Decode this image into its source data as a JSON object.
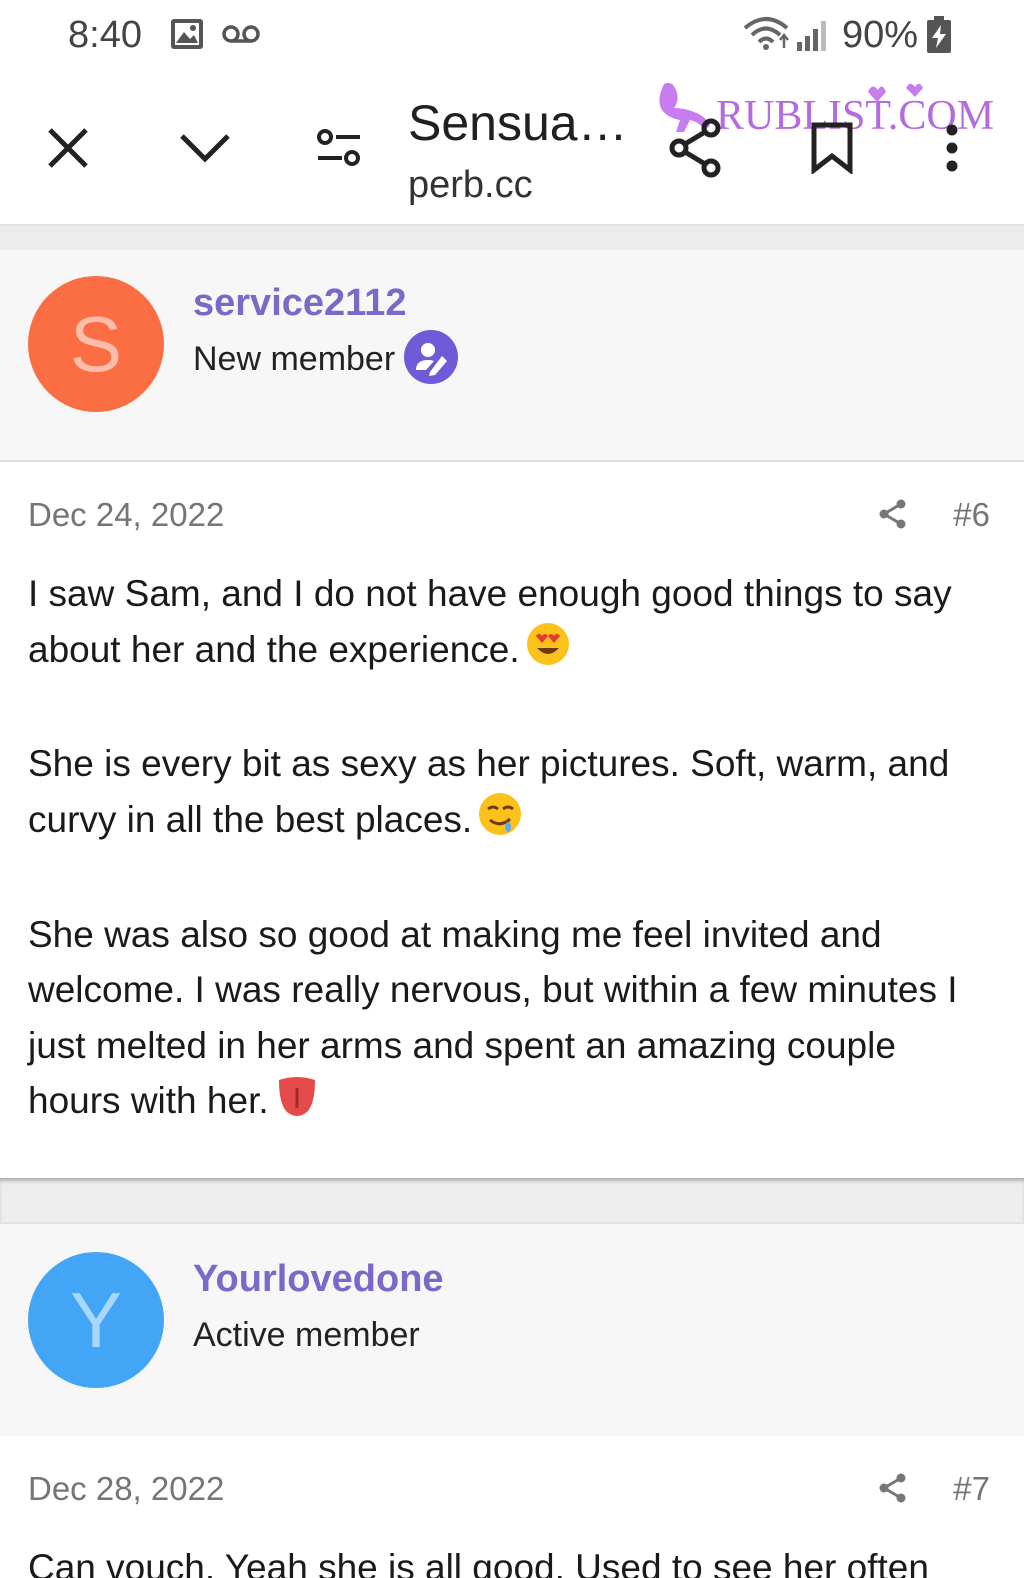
{
  "status_bar": {
    "time": "8:40",
    "battery": "90%",
    "icons": [
      "image-icon",
      "voicemail-icon",
      "wifi-icon",
      "signal-icon",
      "battery-charging-icon"
    ]
  },
  "toolbar": {
    "title": "Sensua…",
    "domain": "perb.cc",
    "icons": [
      "close-icon",
      "chevron-down-icon",
      "tune-icon",
      "share-icon",
      "bookmark-icon",
      "more-vert-icon"
    ]
  },
  "watermark": {
    "text": "RUBLIST.COM"
  },
  "posts": [
    {
      "avatar_letter": "S",
      "avatar_color": "#fb6e43",
      "username": "service2112",
      "role": "New member",
      "date": "Dec 24, 2022",
      "number": "#6",
      "paragraphs": [
        "I saw Sam, and I do not have enough good things to say about her and the experience.",
        "She is every bit as sexy as her pictures. Soft, warm, and curvy in all the best places.",
        "She was also so good at making me feel invited and welcome. I was really nervous, but within a few minutes I just melted in her arms and spent an amazing couple hours with her."
      ]
    },
    {
      "avatar_letter": "Y",
      "avatar_color": "#42a5f5",
      "username": "Yourlovedone",
      "role": "Active member",
      "date": "Dec 28, 2022",
      "number": "#7",
      "paragraphs": [
        "Can vouch. Yeah she is all good. Used to see her often"
      ]
    }
  ],
  "colors": {
    "username": "#7b68c9",
    "meta_text": "#757575",
    "badge": "#6f5bd8"
  }
}
